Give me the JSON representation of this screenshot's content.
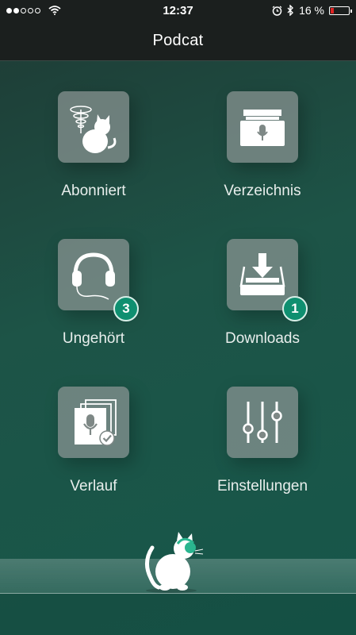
{
  "status_bar": {
    "signal_dots_filled": 2,
    "signal_dots_total": 5,
    "wifi_icon": "wifi-icon",
    "time": "12:37",
    "alarm_icon": "alarm-icon",
    "bluetooth_icon": "bluetooth-icon",
    "battery_percent": "16 %",
    "battery_level": 0.16
  },
  "nav": {
    "title": "Podcat"
  },
  "menu": {
    "subscribed": {
      "label": "Abonniert",
      "icon": "cat-with-signal-icon"
    },
    "directory": {
      "label": "Verzeichnis",
      "icon": "archive-box-icon"
    },
    "unplayed": {
      "label": "Ungehört",
      "icon": "headphones-icon",
      "badge": "3"
    },
    "downloads": {
      "label": "Downloads",
      "icon": "download-tray-icon",
      "badge": "1"
    },
    "history": {
      "label": "Verlauf",
      "icon": "history-icon"
    },
    "settings": {
      "label": "Einstellungen",
      "icon": "sliders-icon"
    }
  },
  "colors": {
    "accent": "#0f8f70",
    "tile": "#8c9694",
    "background": "#1d5447"
  }
}
